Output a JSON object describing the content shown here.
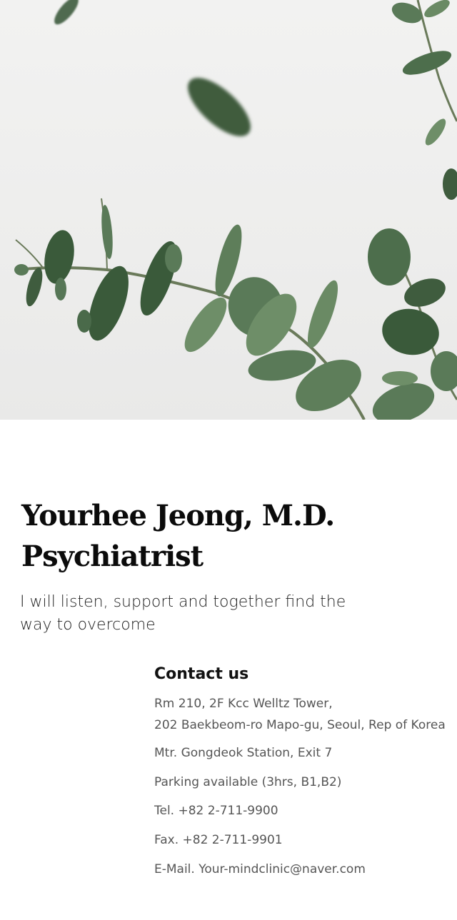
{
  "hero": {
    "image": "eucalyptus-branch-photo"
  },
  "profile": {
    "name_line1": "Yourhee Jeong, M.D.",
    "name_line2": "Psychiatrist",
    "tagline": "I will listen, support and together find the way to overcome"
  },
  "contact": {
    "title": "Contact us",
    "address_line1": "Rm 210, 2F Kcc Welltz Tower,",
    "address_line2": "202 Baekbeom-ro Mapo-gu, Seoul, Rep of Korea",
    "metro": "Mtr. Gongdeok Station, Exit 7",
    "parking": "Parking available (3hrs, B1,B2)",
    "tel": "Tel. +82 2-711-9900",
    "fax": "Fax. +82 2-711-9901",
    "email": "E-Mail. Your-mindclinic@naver.com"
  },
  "colors": {
    "leaf": "#4a6a4a",
    "leaf_light": "#6e8e68",
    "stem": "#6a7a5a"
  }
}
